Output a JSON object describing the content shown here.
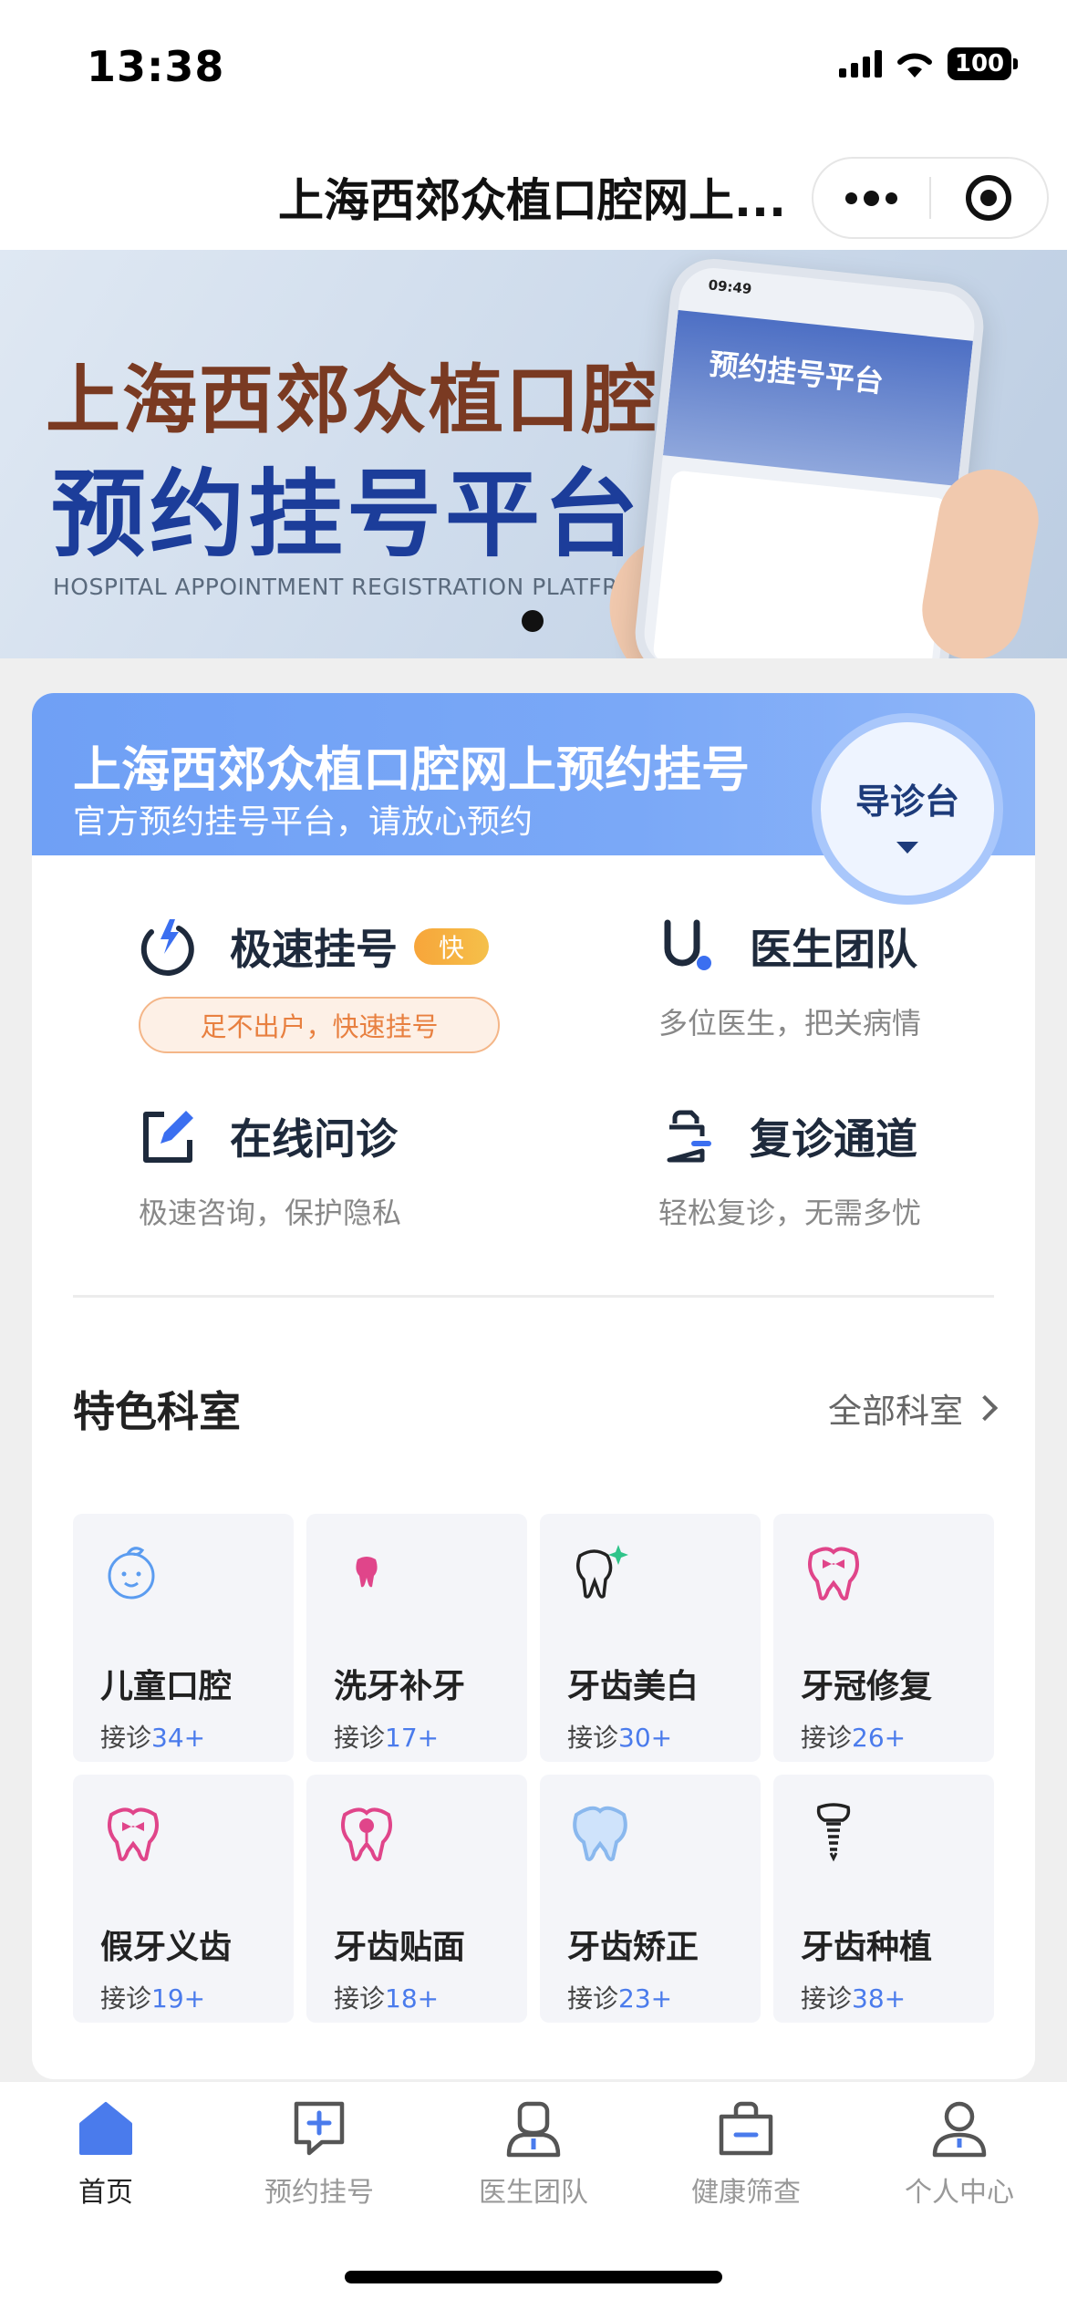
{
  "status": {
    "time": "13:38",
    "battery": "100"
  },
  "nav": {
    "title": "上海西郊众植口腔网上..."
  },
  "banner": {
    "line1": "上海西郊众植口腔",
    "line2": "预约挂号平台",
    "en": "HOSPITAL APPOINTMENT REGISTRATION PLATFROM",
    "phone_time": "09:49",
    "phone_title": "预约挂号平台"
  },
  "header": {
    "title": "上海西郊众植口腔网上预约挂号",
    "subtitle": "官方预约挂号平台，请放心预约",
    "guide_label": "导诊台"
  },
  "services": [
    {
      "title": "极速挂号",
      "badge": "快",
      "desc": "足不出户，快速挂号",
      "icon": "fast-register-icon"
    },
    {
      "title": "医生团队",
      "desc": "多位医生，把关病情",
      "icon": "stethoscope-icon"
    },
    {
      "title": "在线问诊",
      "desc": "极速咨询，保护隐私",
      "icon": "edit-icon"
    },
    {
      "title": "复诊通道",
      "desc": "轻松复诊，无需多忧",
      "icon": "bag-icon"
    }
  ],
  "departments_section": {
    "title": "特色科室",
    "more": "全部科室"
  },
  "departments": [
    {
      "name": "儿童口腔",
      "prefix": "接诊",
      "count": "34+",
      "icon": "baby-face-icon"
    },
    {
      "name": "洗牙补牙",
      "prefix": "接诊",
      "count": "17+",
      "icon": "tooth-icon"
    },
    {
      "name": "牙齿美白",
      "prefix": "接诊",
      "count": "30+",
      "icon": "sparkle-tooth-icon"
    },
    {
      "name": "牙冠修复",
      "prefix": "接诊",
      "count": "26+",
      "icon": "crown-tooth-icon"
    },
    {
      "name": "假牙义齿",
      "prefix": "接诊",
      "count": "19+",
      "icon": "denture-icon"
    },
    {
      "name": "牙齿贴面",
      "prefix": "接诊",
      "count": "18+",
      "icon": "veneer-icon"
    },
    {
      "name": "牙齿矫正",
      "prefix": "接诊",
      "count": "23+",
      "icon": "braces-tooth-icon"
    },
    {
      "name": "牙齿种植",
      "prefix": "接诊",
      "count": "38+",
      "icon": "implant-icon"
    }
  ],
  "tabs": [
    {
      "label": "首页",
      "icon": "home-icon",
      "active": true
    },
    {
      "label": "预约挂号",
      "icon": "chat-plus-icon"
    },
    {
      "label": "医生团队",
      "icon": "doctor-icon"
    },
    {
      "label": "健康筛查",
      "icon": "bag-icon"
    },
    {
      "label": "个人中心",
      "icon": "user-icon"
    }
  ],
  "colors": {
    "accent": "#4a7bec",
    "header": "#6fa0f5",
    "badge": "#f7a53a",
    "pink": "#e0458a"
  }
}
